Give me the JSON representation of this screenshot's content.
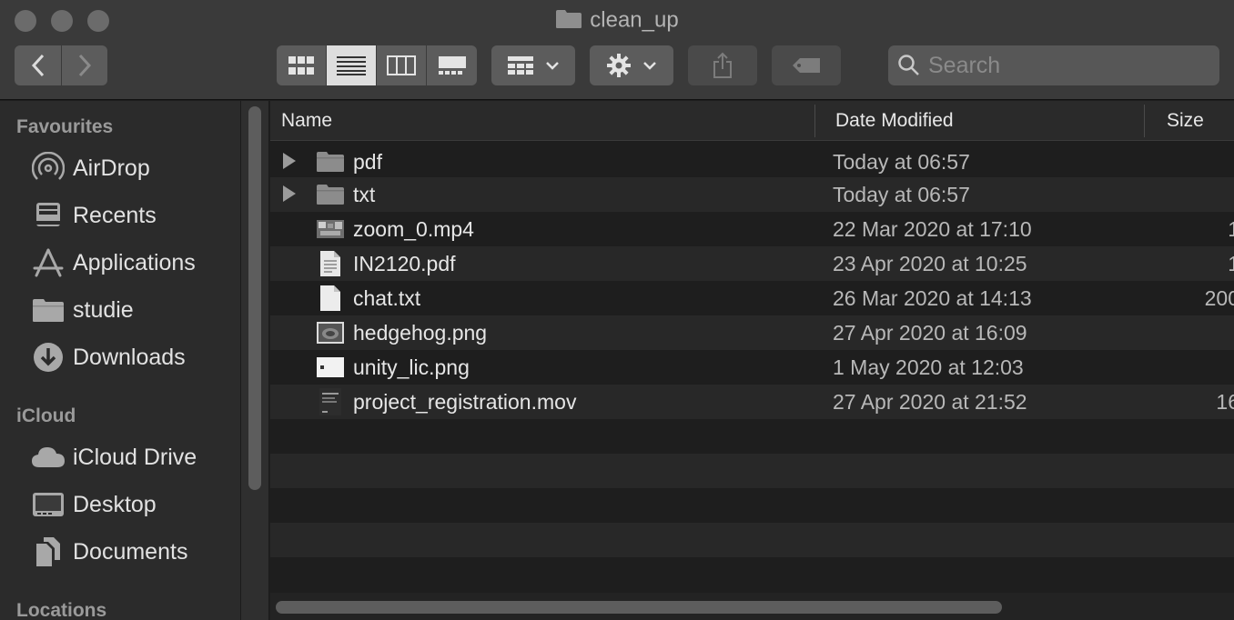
{
  "window": {
    "title": "clean_up"
  },
  "toolbar": {
    "back_icon": "chevron-left-icon",
    "forward_icon": "chevron-right-icon",
    "views": [
      "icon-view",
      "list-view",
      "column-view",
      "gallery-view"
    ],
    "active_view": "list-view",
    "search_placeholder": "Search"
  },
  "sidebar": {
    "sections": [
      {
        "heading": "Favourites",
        "items": [
          {
            "label": "AirDrop",
            "icon": "airdrop-icon"
          },
          {
            "label": "Recents",
            "icon": "recents-icon"
          },
          {
            "label": "Applications",
            "icon": "applications-icon"
          },
          {
            "label": "studie",
            "icon": "folder-icon"
          },
          {
            "label": "Downloads",
            "icon": "downloads-icon"
          }
        ]
      },
      {
        "heading": "iCloud",
        "items": [
          {
            "label": "iCloud Drive",
            "icon": "cloud-icon"
          },
          {
            "label": "Desktop",
            "icon": "desktop-icon"
          },
          {
            "label": "Documents",
            "icon": "documents-icon"
          }
        ]
      },
      {
        "heading": "Locations",
        "items": []
      }
    ]
  },
  "columns": {
    "name": "Name",
    "date": "Date Modified",
    "size": "Size"
  },
  "files": [
    {
      "name": "pdf",
      "date": "Today at 06:57",
      "size": "",
      "kind": "folder"
    },
    {
      "name": "txt",
      "date": "Today at 06:57",
      "size": "",
      "kind": "folder"
    },
    {
      "name": "zoom_0.mp4",
      "date": "22 Mar 2020 at 17:10",
      "size": "1",
      "kind": "video"
    },
    {
      "name": "IN2120.pdf",
      "date": "23 Apr 2020 at 10:25",
      "size": "1",
      "kind": "pdf"
    },
    {
      "name": "chat.txt",
      "date": "26 Mar 2020 at 14:13",
      "size": "200",
      "kind": "text"
    },
    {
      "name": "hedgehog.png",
      "date": "27 Apr 2020 at 16:09",
      "size": "",
      "kind": "image"
    },
    {
      "name": "unity_lic.png",
      "date": "1 May 2020 at 12:03",
      "size": "",
      "kind": "image-small"
    },
    {
      "name": "project_registration.mov",
      "date": "27 Apr 2020 at 21:52",
      "size": "16",
      "kind": "movie"
    }
  ],
  "colors": {
    "window_bg": "#1e1e1e",
    "toolbar_bg": "#3a3a3a",
    "sidebar_bg": "#2b2b2b",
    "row_alt": "#282828"
  }
}
